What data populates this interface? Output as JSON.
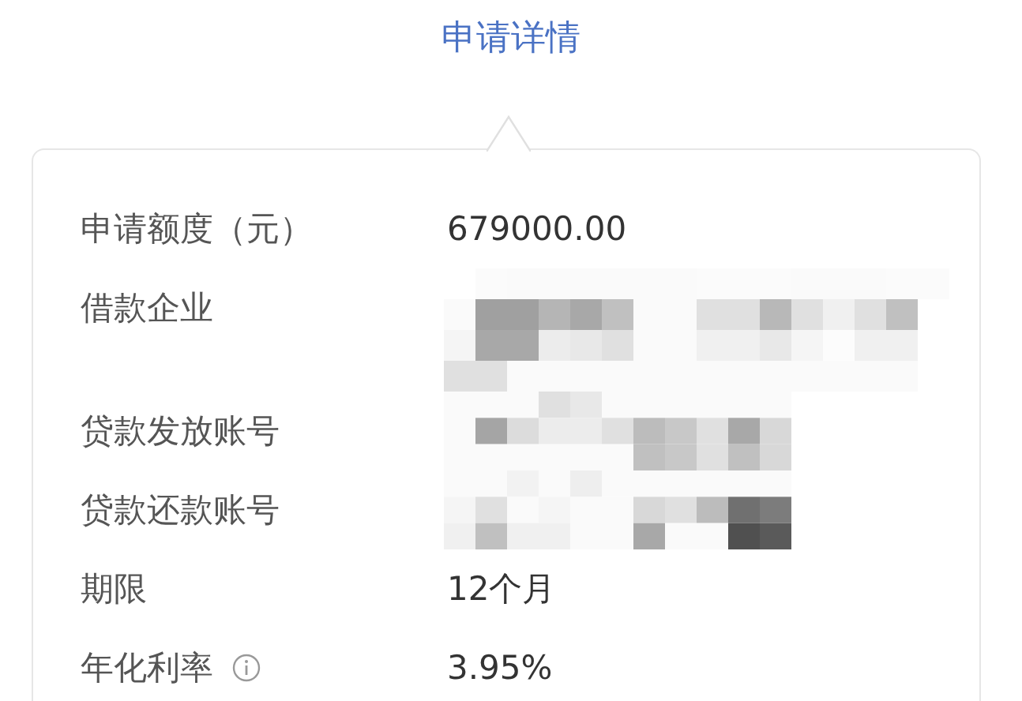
{
  "title": "申请详情",
  "rows": [
    {
      "label": "申请额度（元）",
      "kind": "text",
      "value": "679000.00",
      "info": false
    },
    {
      "label": "借款企业",
      "kind": "redacted",
      "info": false
    },
    {
      "label": "贷款发放账号",
      "kind": "redacted",
      "info": false
    },
    {
      "label": "贷款还款账号",
      "kind": "redacted",
      "info": false
    },
    {
      "label": "期限",
      "kind": "text",
      "value": "12个月",
      "info": false
    },
    {
      "label": "年化利率",
      "kind": "text",
      "value": "3.95%",
      "info": true
    }
  ]
}
